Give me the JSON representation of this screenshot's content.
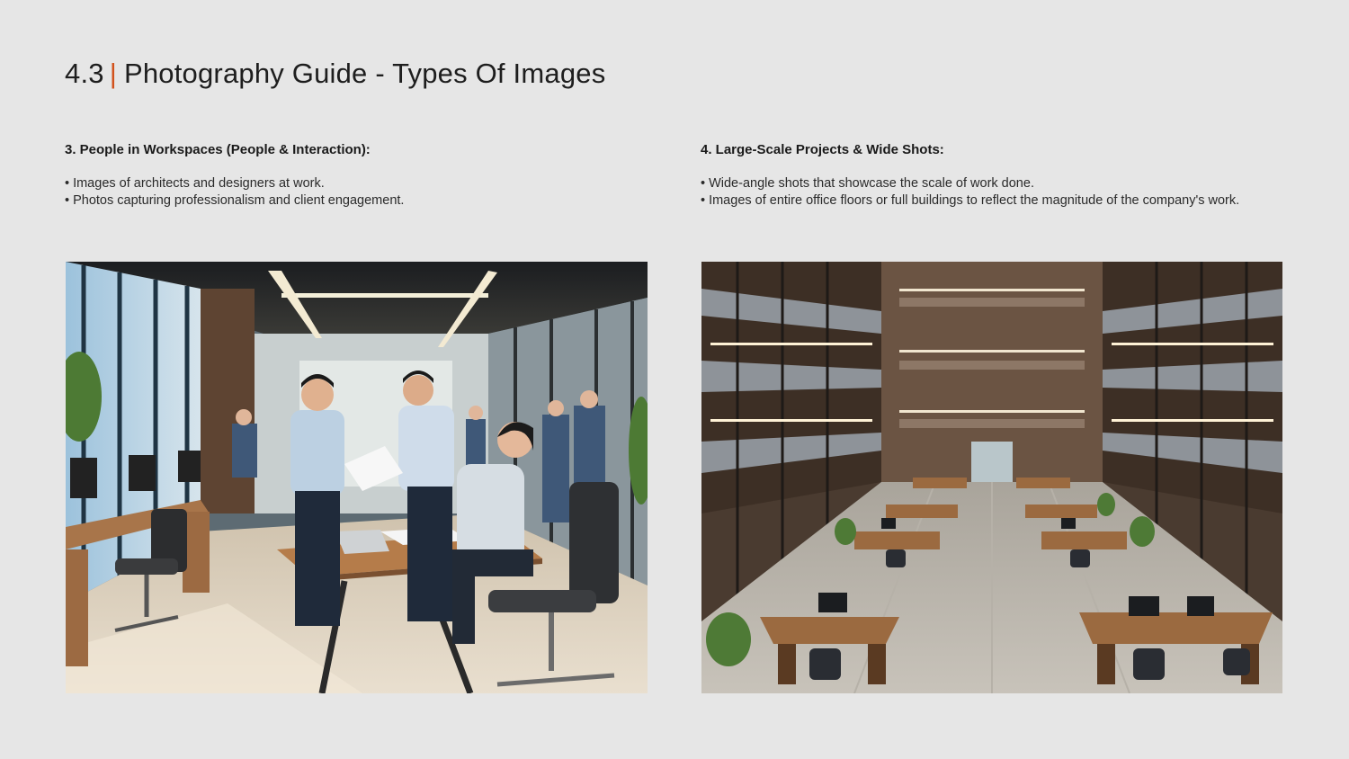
{
  "header": {
    "section_number": "4.3",
    "separator": "|",
    "title": "Photography Guide - Types Of Images",
    "accent_color": "#d2521c"
  },
  "sections": [
    {
      "heading": "3. People in Workspaces (People & Interaction):",
      "bullets": [
        "Images of architects and designers at work.",
        "Photos capturing professionalism and client engagement."
      ]
    },
    {
      "heading": "4. Large-Scale Projects & Wide Shots:",
      "bullets": [
        "Wide-angle shots that showcase the scale of work done.",
        "Images of entire office floors or full buildings to reflect the magnitude of the company's work."
      ]
    }
  ]
}
